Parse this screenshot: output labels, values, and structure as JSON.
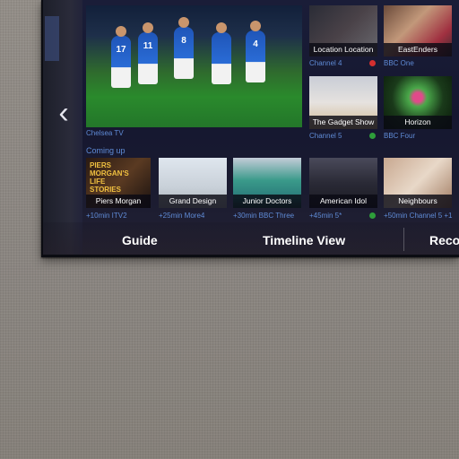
{
  "now_tiles": [
    {
      "label": "Location Location",
      "channel": "Channel 4",
      "dot": "#d32f2f"
    },
    {
      "label": "EastEnders",
      "channel": "BBC One",
      "dot": null
    },
    {
      "label": "The Gadget Show",
      "channel": "Channel 5",
      "dot": "#2e9e3a"
    },
    {
      "label": "Horizon",
      "channel": "BBC Four",
      "dot": null
    }
  ],
  "main_tile": {
    "channel": "Chelsea TV",
    "player_numbers": [
      "17",
      "11",
      "8",
      "4"
    ]
  },
  "coming_up": {
    "heading": "Coming up",
    "items": [
      {
        "label": "Piers Morgan",
        "time": "+10min ITV2",
        "overlay": "PIERS MORGAN'S LIFE STORIES"
      },
      {
        "label": "Grand Design",
        "time": "+25min More4"
      },
      {
        "label": "Junior Doctors",
        "time": "+30min BBC Three"
      },
      {
        "label": "American Idol",
        "time": "+45min 5*"
      },
      {
        "label": "Neighbours",
        "time": "+50min Channel 5 +1"
      }
    ]
  },
  "nav": {
    "guide": "Guide",
    "timeline": "Timeline View",
    "record": "Reco"
  },
  "colors": {
    "accent_blue": "#5f8bd6",
    "rec_red": "#d32f2f",
    "green": "#2e9e3a"
  }
}
